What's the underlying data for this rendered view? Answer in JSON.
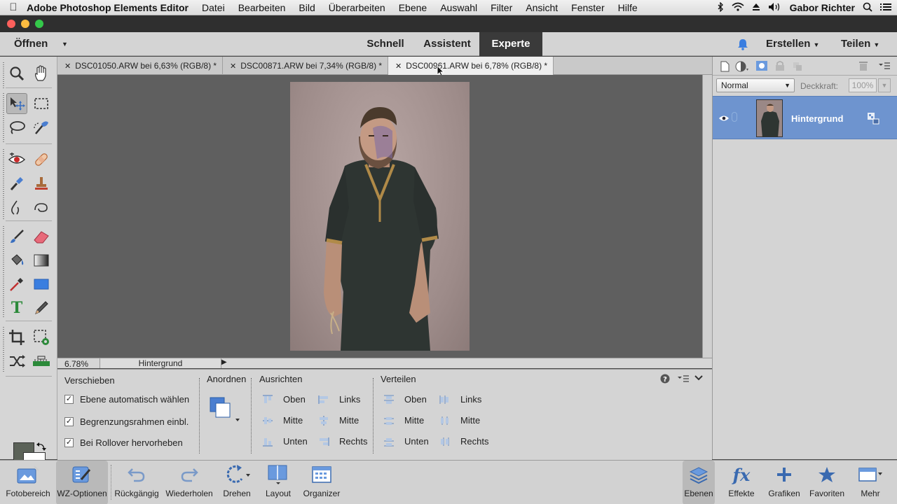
{
  "menubar": {
    "app_name": "Adobe Photoshop Elements Editor",
    "items": [
      "Datei",
      "Bearbeiten",
      "Bild",
      "Überarbeiten",
      "Ebene",
      "Auswahl",
      "Filter",
      "Ansicht",
      "Fenster",
      "Hilfe"
    ],
    "user": "Gabor Richter"
  },
  "appbar": {
    "open_label": "Öffnen",
    "modes": {
      "quick": "Schnell",
      "guided": "Assistent",
      "expert": "Experte"
    },
    "active_mode": "Experte",
    "create_label": "Erstellen",
    "share_label": "Teilen"
  },
  "doc_tabs": [
    {
      "title": "DSC01050.ARW bei 6,63% (RGB/8) *"
    },
    {
      "title": "DSC00871.ARW bei 7,34% (RGB/8) *"
    },
    {
      "title": "DSC00961.ARW bei 6,78% (RGB/8) *"
    }
  ],
  "status": {
    "zoom": "6.78%",
    "layer": "Hintergrund"
  },
  "tool_options": {
    "tool_name": "Verschieben",
    "checkboxes": [
      {
        "label": "Ebene automatisch wählen",
        "checked": true
      },
      {
        "label": "Begrenzungsrahmen einbl.",
        "checked": true
      },
      {
        "label": "Bei Rollover hervorheben",
        "checked": true
      }
    ],
    "arrange_title": "Anordnen",
    "align_title": "Ausrichten",
    "align_items": [
      "Oben",
      "Mitte",
      "Unten",
      "Links",
      "Mitte",
      "Rechts"
    ],
    "distribute_title": "Verteilen",
    "distribute_items": [
      "Oben",
      "Mitte",
      "Unten",
      "Links",
      "Mitte",
      "Rechts"
    ]
  },
  "layers_panel": {
    "blend_mode": "Normal",
    "opacity_label": "Deckkraft:",
    "opacity_value": "100%",
    "layers": [
      {
        "name": "Hintergrund"
      }
    ]
  },
  "bottom_bar": {
    "left": [
      "Fotobereich",
      "WZ-Optionen",
      "Rückgängig",
      "Wiederholen",
      "Drehen",
      "Layout",
      "Organizer"
    ],
    "right": [
      "Ebenen",
      "Effekte",
      "Grafiken",
      "Favoriten",
      "Mehr"
    ]
  },
  "colors": {
    "accent_blue": "#6e94cf",
    "foreground_color": "#5b6258",
    "background_color": "#ffffff"
  }
}
